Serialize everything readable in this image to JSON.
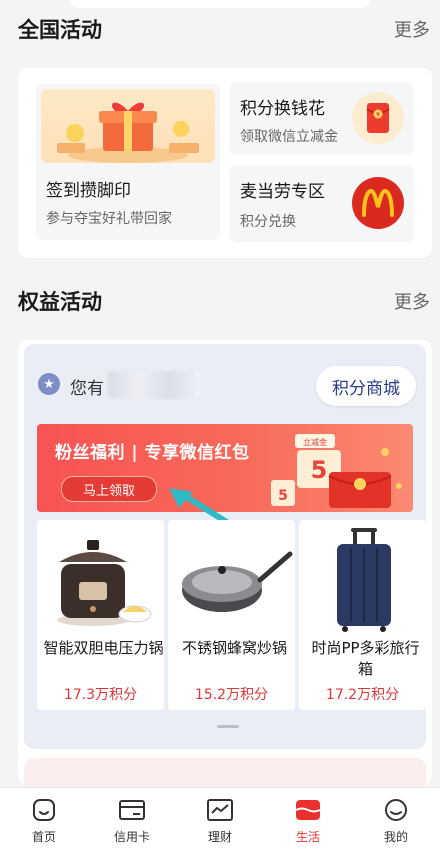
{
  "national": {
    "title": "全国活动",
    "more": "更多",
    "tiles": [
      {
        "title": "签到攒脚印",
        "subtitle": "参与夺宝好礼带回家"
      },
      {
        "title": "积分换钱花",
        "subtitle": "领取微信立减金"
      },
      {
        "title": "麦当劳专区",
        "subtitle": "积分兑换"
      }
    ]
  },
  "rights": {
    "title": "权益活动",
    "more": "更多",
    "points_label": "您有",
    "mall_button": "积分商城",
    "banner": {
      "title": "粉丝福利 | 专享微信红包",
      "button": "马上领取",
      "tag": "立减金"
    },
    "products": [
      {
        "name": "智能双胆电压力锅",
        "price": "17.3万积分",
        "icon": "pressure-cooker"
      },
      {
        "name": "不锈钢蜂窝炒锅",
        "price": "15.2万积分",
        "icon": "wok"
      },
      {
        "name": "时尚PP多彩旅行箱",
        "price": "17.2万积分",
        "icon": "suitcase"
      }
    ]
  },
  "nav": [
    {
      "label": "首页",
      "icon": "home-icon",
      "active": false
    },
    {
      "label": "信用卡",
      "icon": "credit-card-icon",
      "active": false
    },
    {
      "label": "理财",
      "icon": "chart-icon",
      "active": false
    },
    {
      "label": "生活",
      "icon": "life-icon",
      "active": true
    },
    {
      "label": "我的",
      "icon": "profile-icon",
      "active": false
    }
  ],
  "colors": {
    "accent": "#e8302f",
    "price": "#d9383a",
    "mall_text": "#2a3c8c"
  }
}
